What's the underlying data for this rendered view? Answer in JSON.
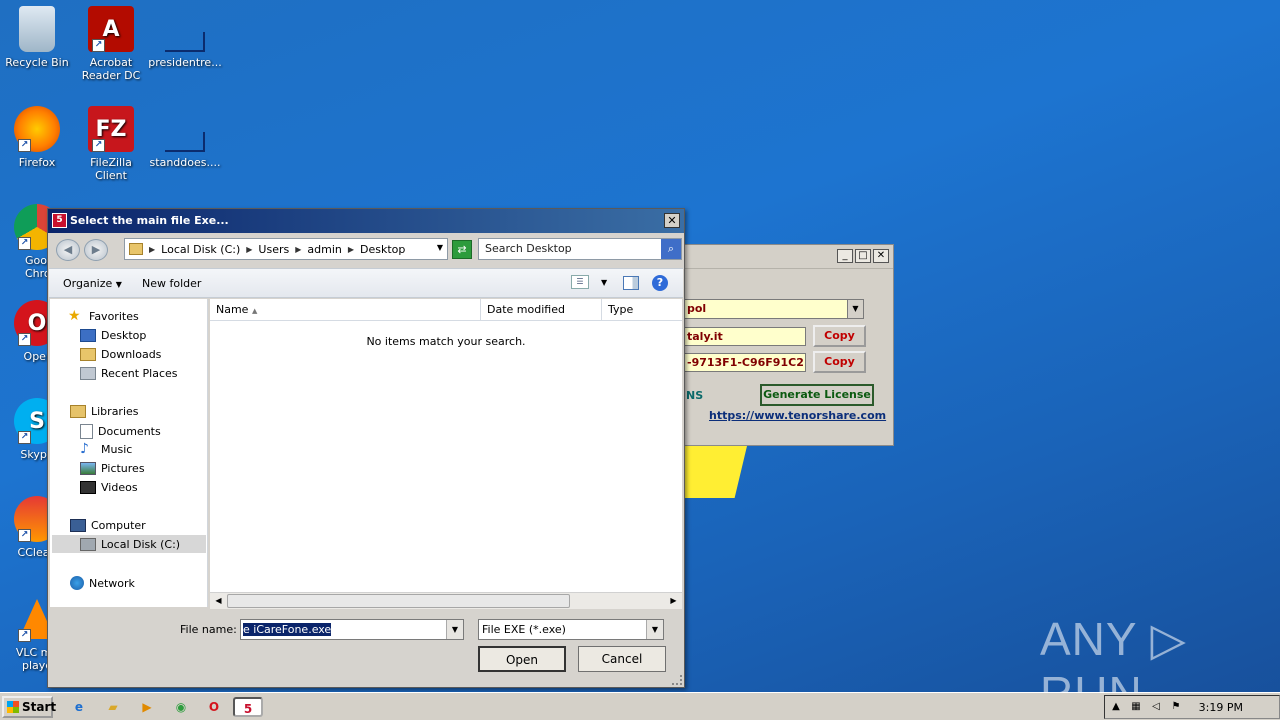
{
  "desktop": {
    "icons": [
      {
        "label": "Recycle Bin",
        "icon": "recycle-bin-icon"
      },
      {
        "label": "Acrobat Reader DC",
        "icon": "acrobat-icon"
      },
      {
        "label": "presidentre...",
        "icon": "document-icon"
      },
      {
        "label": "Firefox",
        "icon": "firefox-icon"
      },
      {
        "label": "FileZilla Client",
        "icon": "filezilla-icon"
      },
      {
        "label": "standdoes....",
        "icon": "document-icon"
      },
      {
        "label": "Googl Chrom",
        "icon": "chrome-icon"
      },
      {
        "label": "Oper",
        "icon": "opera-icon"
      },
      {
        "label": "Skype",
        "icon": "skype-icon"
      },
      {
        "label": "CClean",
        "icon": "ccleaner-icon"
      },
      {
        "label": "VLC me playe",
        "icon": "vlc-icon"
      }
    ]
  },
  "license_window": {
    "product_select": "pol",
    "email_field": "taly.it",
    "key_field": "-9713F1-C96F91C2",
    "copy_label": "Copy",
    "ns_text": "NS",
    "generate_label": "Generate License",
    "link": "https://www.tenorshare.com"
  },
  "dialog": {
    "title": "Select the main file Exe...",
    "close": "✕",
    "breadcrumbs": [
      "Local Disk (C:)",
      "Users",
      "admin",
      "Desktop"
    ],
    "search_placeholder": "Search Desktop",
    "toolbar": {
      "organize": "Organize",
      "new_folder": "New folder"
    },
    "nav": {
      "favorites": "Favorites",
      "desktop": "Desktop",
      "downloads": "Downloads",
      "recent": "Recent Places",
      "libraries": "Libraries",
      "documents": "Documents",
      "music": "Music",
      "pictures": "Pictures",
      "videos": "Videos",
      "computer": "Computer",
      "local_disk": "Local Disk (C:)",
      "network": "Network"
    },
    "columns": {
      "name": "Name",
      "date_modified": "Date modified",
      "type": "Type"
    },
    "empty_message": "No items match your search.",
    "file_name_label": "File name:",
    "file_name_value": "e iCareFone.exe",
    "file_type": "File EXE (*.exe)",
    "open_label": "Open",
    "cancel_label": "Cancel"
  },
  "watermark": "ANY ▷ RUN",
  "taskbar": {
    "start_label": "Start",
    "clock": "3:19 PM"
  }
}
